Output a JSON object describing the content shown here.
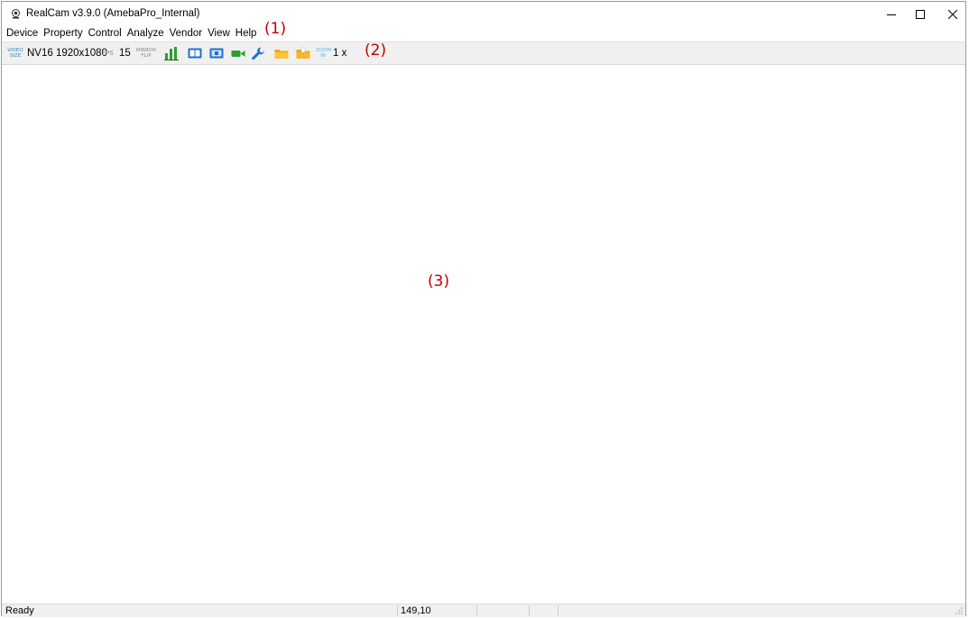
{
  "window": {
    "title": "RealCam v3.9.0 (AmebaPro_Internal)",
    "controls": {
      "minimize": "–",
      "maximize": "☐",
      "close": "✕"
    }
  },
  "menubar": {
    "items": [
      "Device",
      "Property",
      "Control",
      "Analyze",
      "Vendor",
      "View",
      "Help"
    ]
  },
  "annotations": {
    "menu": "(1)",
    "toolbar": "(2)",
    "main": "(3)"
  },
  "toolbar": {
    "video_size_icon_text": "VIDEO SIZE",
    "resolution": "NV16 1920x1080",
    "fps_icon_text": "FPS",
    "fps_value": "15",
    "mirror_icon_text": "MIRROR FLIP",
    "zoom_icon_text": "ZOOM IN",
    "zoom_value": "1 x",
    "icons": [
      "video-size-icon",
      "fps-icon",
      "mirror-flip-icon",
      "histogram-icon",
      "view-single-icon",
      "view-split-icon",
      "record-camera-icon",
      "wrench-icon",
      "folder-open-icon",
      "folder-save-icon",
      "zoom-in-icon"
    ],
    "colors": {
      "green": "#2e9e2e",
      "blue": "#1f6fd1",
      "orange": "#f2a516"
    }
  },
  "statusbar": {
    "status": "Ready",
    "coordinates": "149,10"
  }
}
